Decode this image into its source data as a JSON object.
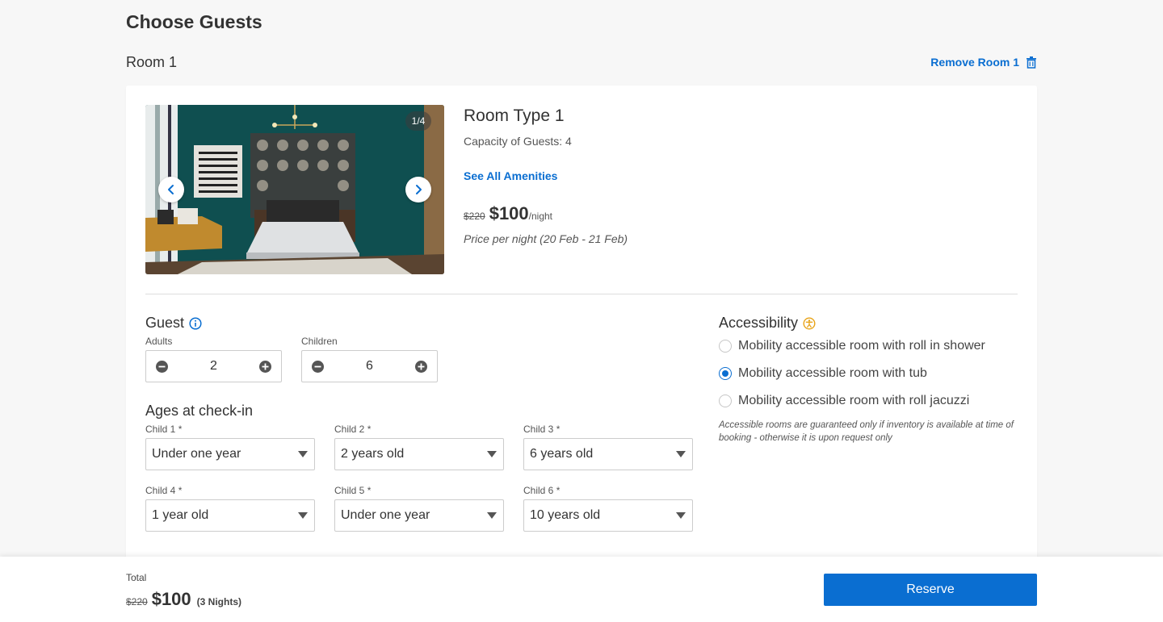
{
  "header": {
    "title": "Choose Guests",
    "room_label": "Room 1",
    "remove_room_label": "Remove Room 1"
  },
  "room": {
    "photo_counter": "1/4",
    "type_title": "Room Type 1",
    "capacity": "Capacity of Guests: 4",
    "amenities_link": "See All Amenities",
    "old_price": "$220",
    "price": "$100",
    "per_night": "/night",
    "price_note": "Price per night (20 Feb - 21 Feb)"
  },
  "guest": {
    "title": "Guest",
    "adults_label": "Adults",
    "adults_value": "2",
    "children_label": "Children",
    "children_value": "6"
  },
  "ages": {
    "title": "Ages at check-in",
    "children": [
      {
        "label": "Child 1 *",
        "value": "Under one year"
      },
      {
        "label": "Child 2 *",
        "value": "2 years old"
      },
      {
        "label": "Child 3 *",
        "value": "6 years old"
      },
      {
        "label": "Child 4 *",
        "value": "1 year old"
      },
      {
        "label": "Child 5 *",
        "value": "Under one year"
      },
      {
        "label": "Child 6 *",
        "value": "10 years old"
      }
    ]
  },
  "accessibility": {
    "title": "Accessibility",
    "options": [
      {
        "label": "Mobility accessible room with roll in shower",
        "selected": false
      },
      {
        "label": "Mobility accessible room with tub",
        "selected": true
      },
      {
        "label": "Mobility accessible room with roll jacuzzi",
        "selected": false
      }
    ],
    "note": "Accessible rooms are guaranteed only if inventory is available at time of booking - otherwise it is upon request only"
  },
  "footer": {
    "total_label": "Total",
    "old_total": "$220",
    "total": "$100",
    "nights": "(3 Nights)",
    "reserve_label": "Reserve"
  },
  "colors": {
    "accent": "#0a6ed1",
    "accessibility_icon": "#e8a317",
    "background": "#f7f7f7"
  },
  "icons": [
    "trash-icon",
    "chevron-left-icon",
    "chevron-right-icon",
    "info-icon",
    "minus-circle-icon",
    "plus-circle-icon",
    "accessibility-icon",
    "caret-down-icon"
  ]
}
